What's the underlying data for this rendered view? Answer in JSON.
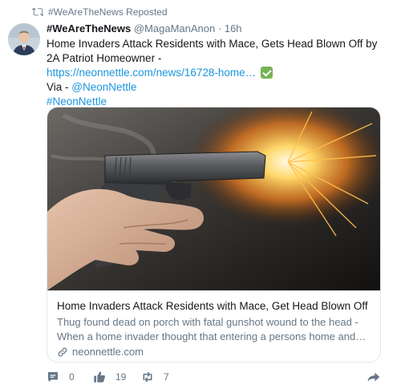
{
  "repost": {
    "text": "#WeAreTheNews Reposted",
    "icon": "repost-icon"
  },
  "tweet": {
    "display_name": "#WeAreTheNews",
    "handle": "@MagaManAnon",
    "separator": "·",
    "time": "16h",
    "headline": "Home Invaders Attack Residents with Mace, Gets Head Blown Off by 2A Patriot Homeowner -",
    "url": "https://neonnettle.com/news/16728-home…",
    "via_label": "Via -",
    "via_handle": "@NeonNettle",
    "hashtag": "#NeonNettle",
    "check_icon": "white-heavy-check-mark-icon"
  },
  "card": {
    "title": "Home Invaders Attack Residents with Mace, Get Head Blown Off by …",
    "description": "Thug found dead on porch with fatal gunshot wound to the head - When a home invader thought that entering a persons home and…",
    "domain": "neonnettle.com",
    "domain_icon": "link-icon"
  },
  "actions": {
    "reply": {
      "icon": "comment-icon",
      "count": "0"
    },
    "like": {
      "icon": "thumbs-up-icon",
      "count": "19"
    },
    "repost": {
      "icon": "repost-icon",
      "count": "7"
    },
    "share": {
      "icon": "share-arrow-icon"
    }
  },
  "colors": {
    "link": "#1b95e0",
    "muted": "#657786",
    "text": "#14171a",
    "border": "#e1e8ed"
  }
}
